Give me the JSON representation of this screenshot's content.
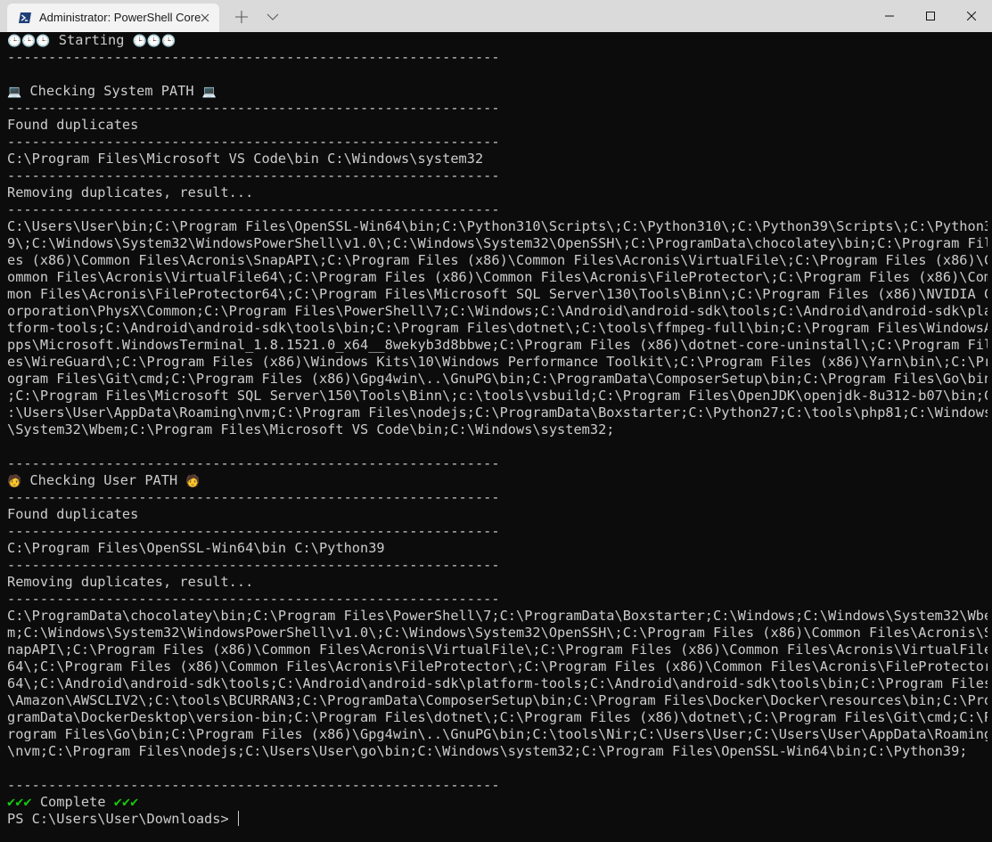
{
  "window": {
    "tab_title": "Administrator: PowerShell Core",
    "tab_icon": "powershell-icon",
    "new_tab_icon": "plus-icon",
    "dropdown_icon": "chevron-down-icon",
    "controls": [
      "minimize-icon",
      "maximize-icon",
      "close-icon"
    ]
  },
  "terminal": {
    "starting_text": " Starting ",
    "starting_icon": "clock-emoji",
    "separator": "------------------------------------------------------------",
    "system_section": {
      "title": " Checking System PATH ",
      "icon": "computer-emoji",
      "found_dup": "Found duplicates",
      "duplicates": "C:\\Program Files\\Microsoft VS Code\\bin C:\\Windows\\system32",
      "removing": "Removing duplicates, result...",
      "result_lines": [
        "C:\\Users\\User\\bin;C:\\Program Files\\OpenSSL-Win64\\bin;C:\\Python310\\Scripts\\;C:\\Python310\\;C:\\Python39\\Scripts\\;C:\\Python3",
        "9\\;C:\\Windows\\System32\\WindowsPowerShell\\v1.0\\;C:\\Windows\\System32\\OpenSSH\\;C:\\ProgramData\\chocolatey\\bin;C:\\Program Fil",
        "es (x86)\\Common Files\\Acronis\\SnapAPI\\;C:\\Program Files (x86)\\Common Files\\Acronis\\VirtualFile\\;C:\\Program Files (x86)\\C",
        "ommon Files\\Acronis\\VirtualFile64\\;C:\\Program Files (x86)\\Common Files\\Acronis\\FileProtector\\;C:\\Program Files (x86)\\Com",
        "mon Files\\Acronis\\FileProtector64\\;C:\\Program Files\\Microsoft SQL Server\\130\\Tools\\Binn\\;C:\\Program Files (x86)\\NVIDIA C",
        "orporation\\PhysX\\Common;C:\\Program Files\\PowerShell\\7;C:\\Windows;C:\\Android\\android-sdk\\tools;C:\\Android\\android-sdk\\pla",
        "tform-tools;C:\\Android\\android-sdk\\tools\\bin;C:\\Program Files\\dotnet\\;C:\\tools\\ffmpeg-full\\bin;C:\\Program Files\\WindowsA",
        "pps\\Microsoft.WindowsTerminal_1.8.1521.0_x64__8wekyb3d8bbwe;C:\\Program Files (x86)\\dotnet-core-uninstall\\;C:\\Program Fil",
        "es\\WireGuard\\;C:\\Program Files (x86)\\Windows Kits\\10\\Windows Performance Toolkit\\;C:\\Program Files (x86)\\Yarn\\bin\\;C:\\Pr",
        "ogram Files\\Git\\cmd;C:\\Program Files (x86)\\Gpg4win\\..\\GnuPG\\bin;C:\\ProgramData\\ComposerSetup\\bin;C:\\Program Files\\Go\\bin",
        ";C:\\Program Files\\Microsoft SQL Server\\150\\Tools\\Binn\\;c:\\tools\\vsbuild;C:\\Program Files\\OpenJDK\\openjdk-8u312-b07\\bin;C",
        ":\\Users\\User\\AppData\\Roaming\\nvm;C:\\Program Files\\nodejs;C:\\ProgramData\\Boxstarter;C:\\Python27;C:\\tools\\php81;C:\\Windows",
        "\\System32\\Wbem;C:\\Program Files\\Microsoft VS Code\\bin;C:\\Windows\\system32;"
      ]
    },
    "user_section": {
      "title": " Checking User PATH ",
      "icon": "person-emoji",
      "found_dup": "Found duplicates",
      "duplicates": "C:\\Program Files\\OpenSSL-Win64\\bin C:\\Python39",
      "removing": "Removing duplicates, result...",
      "result_lines": [
        "C:\\ProgramData\\chocolatey\\bin;C:\\Program Files\\PowerShell\\7;C:\\ProgramData\\Boxstarter;C:\\Windows;C:\\Windows\\System32\\Wbe",
        "m;C:\\Windows\\System32\\WindowsPowerShell\\v1.0\\;C:\\Windows\\System32\\OpenSSH\\;C:\\Program Files (x86)\\Common Files\\Acronis\\S",
        "napAPI\\;C:\\Program Files (x86)\\Common Files\\Acronis\\VirtualFile\\;C:\\Program Files (x86)\\Common Files\\Acronis\\VirtualFile",
        "64\\;C:\\Program Files (x86)\\Common Files\\Acronis\\FileProtector\\;C:\\Program Files (x86)\\Common Files\\Acronis\\FileProtector",
        "64\\;C:\\Android\\android-sdk\\tools;C:\\Android\\android-sdk\\platform-tools;C:\\Android\\android-sdk\\tools\\bin;C:\\Program Files",
        "\\Amazon\\AWSCLIV2\\;C:\\tools\\BCURRAN3;C:\\ProgramData\\ComposerSetup\\bin;C:\\Program Files\\Docker\\Docker\\resources\\bin;C:\\Pro",
        "gramData\\DockerDesktop\\version-bin;C:\\Program Files\\dotnet\\;C:\\Program Files (x86)\\dotnet\\;C:\\Program Files\\Git\\cmd;C:\\P",
        "rogram Files\\Go\\bin;C:\\Program Files (x86)\\Gpg4win\\..\\GnuPG\\bin;C:\\tools\\Nir;C:\\Users\\User;C:\\Users\\User\\AppData\\Roaming",
        "\\nvm;C:\\Program Files\\nodejs;C:\\Users\\User\\go\\bin;C:\\Windows\\system32;C:\\Program Files\\OpenSSL-Win64\\bin;C:\\Python39;"
      ]
    },
    "complete_text": " Complete ",
    "complete_icon": "check-mark-emoji",
    "prompt": "PS C:\\Users\\User\\Downloads> "
  }
}
